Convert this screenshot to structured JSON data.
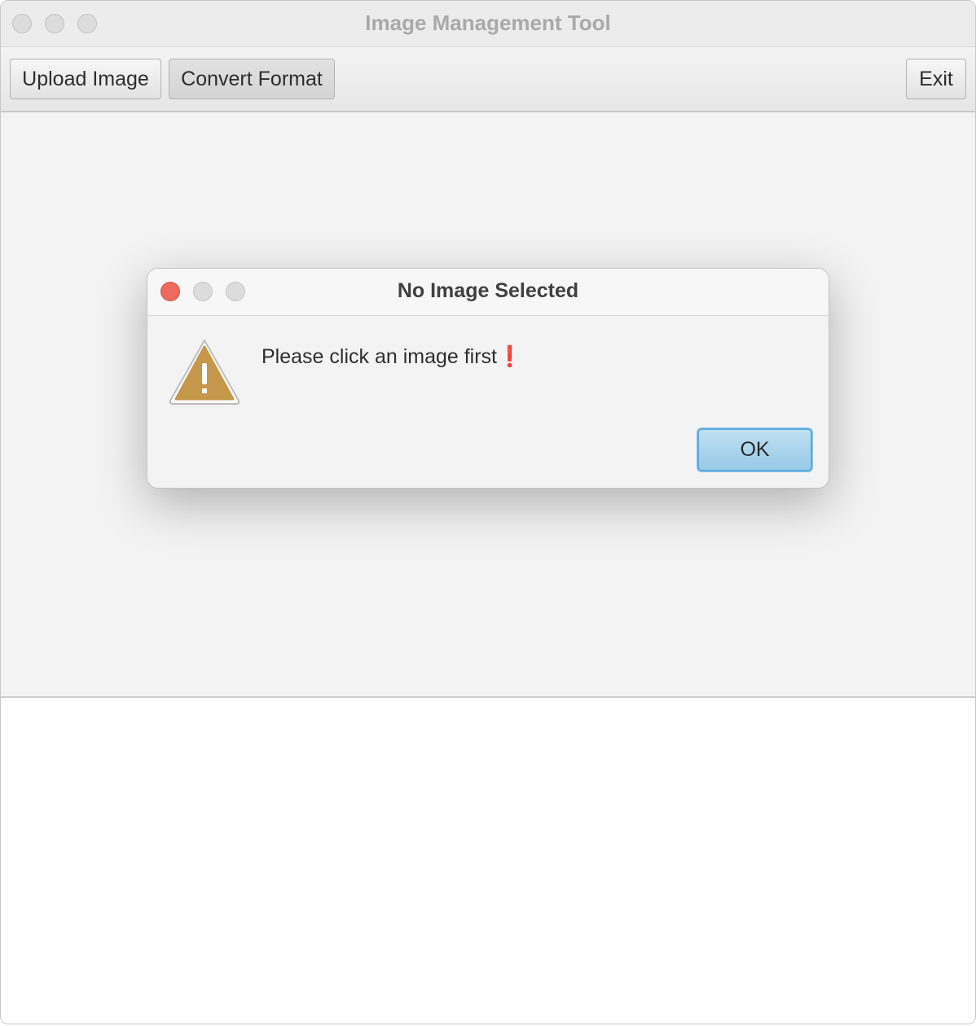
{
  "window": {
    "title": "Image Management Tool"
  },
  "toolbar": {
    "upload_label": "Upload Image",
    "convert_label": "Convert Format",
    "exit_label": "Exit"
  },
  "dialog": {
    "title": "No Image Selected",
    "message": "Please click an image first",
    "message_suffix": "❗",
    "ok_label": "OK",
    "icon": "warning-icon",
    "close_color": "#ec6a5e",
    "accent_color": "#98c9e6"
  }
}
